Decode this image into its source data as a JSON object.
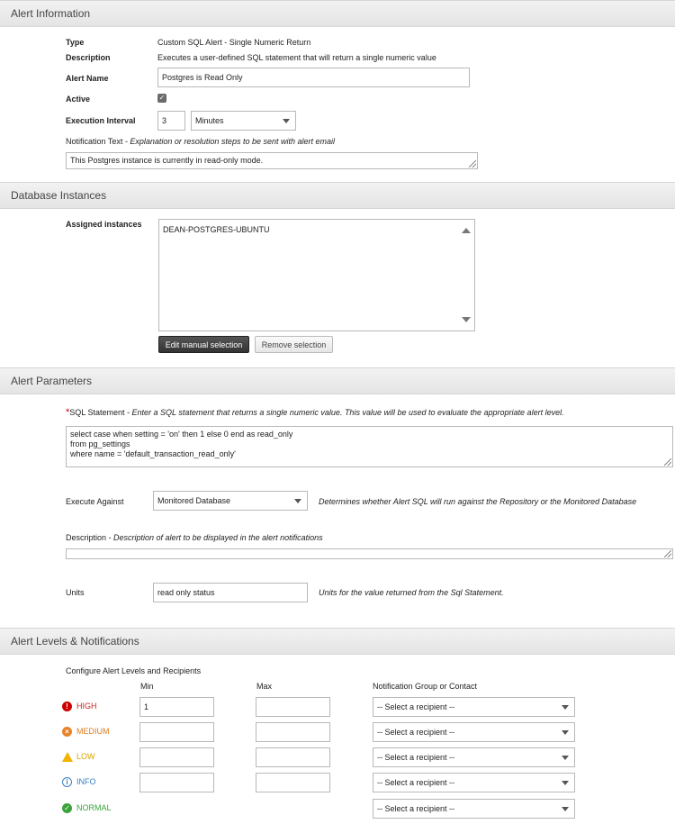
{
  "sections": {
    "alert_information": "Alert Information",
    "database_instances": "Database Instances",
    "alert_parameters": "Alert Parameters",
    "alert_levels": "Alert Levels & Notifications"
  },
  "alert_info": {
    "type_label": "Type",
    "type_value": "Custom SQL Alert - Single Numeric Return",
    "description_label": "Description",
    "description_value": "Executes a user-defined SQL statement that will return a single numeric value",
    "alert_name_label": "Alert Name",
    "alert_name_value": "Postgres is Read Only",
    "active_label": "Active",
    "active_checked": true,
    "execution_interval_label": "Execution Interval",
    "execution_interval_value": "3",
    "execution_interval_unit": "Minutes",
    "notification_label": "Notification Text",
    "notification_hint": " - Explanation or resolution steps to be sent with alert email",
    "notification_value": "This Postgres instance is currently in read-only mode."
  },
  "db_instances": {
    "assigned_label": "Assigned instances",
    "instance_name": "DEAN-POSTGRES-UBUNTU",
    "edit_button": "Edit manual selection",
    "remove_button": "Remove selection"
  },
  "params": {
    "required_mark": "*",
    "sql_label": "SQL Statement",
    "sql_hint": " - Enter a SQL statement that returns a single numeric value. This value will be used to evaluate the appropriate alert level.",
    "sql_lines": [
      "select case when setting = 'on' then 1 else 0 end as read_only",
      "from pg_settings",
      "where name  = 'default_transaction_read_only'"
    ],
    "execute_against_label": "Execute Against",
    "execute_against_value": "Monitored Database",
    "execute_against_hint": "Determines whether Alert SQL will run against the Repository or the Monitored Database",
    "description_label": "Description",
    "description_hint": " - Description of alert to be displayed in the alert notifications",
    "description_value": "",
    "units_label": "Units",
    "units_value": "read only status",
    "units_hint": "Units for the value returned from the Sql Statement."
  },
  "levels": {
    "configure_label": "Configure Alert Levels and Recipients",
    "min_header": "Min",
    "max_header": "Max",
    "group_header": "Notification Group or Contact",
    "recipient_placeholder": "-- Select a recipient --",
    "rows": [
      {
        "name": "HIGH",
        "icon": "error-icon",
        "glyph": "!",
        "color": "#cc0000",
        "text_color": "#cc2222",
        "min": "1",
        "max": ""
      },
      {
        "name": "MEDIUM",
        "icon": "x-circle-icon",
        "glyph": "×",
        "color": "#e8832a",
        "text_color": "#e07b20",
        "min": "",
        "max": ""
      },
      {
        "name": "LOW",
        "icon": "warning-icon",
        "glyph": "!",
        "color": "#f0b400",
        "text_color": "#d9a400",
        "min": "",
        "max": ""
      },
      {
        "name": "INFO",
        "icon": "info-icon",
        "glyph": "i",
        "color": "#3a7fc4",
        "text_color": "#3a7fc4",
        "min": "",
        "max": ""
      },
      {
        "name": "NORMAL",
        "icon": "check-circle-icon",
        "glyph": "✓",
        "color": "#3aa43a",
        "text_color": "#3aa43a",
        "min": null,
        "max": null
      }
    ]
  }
}
